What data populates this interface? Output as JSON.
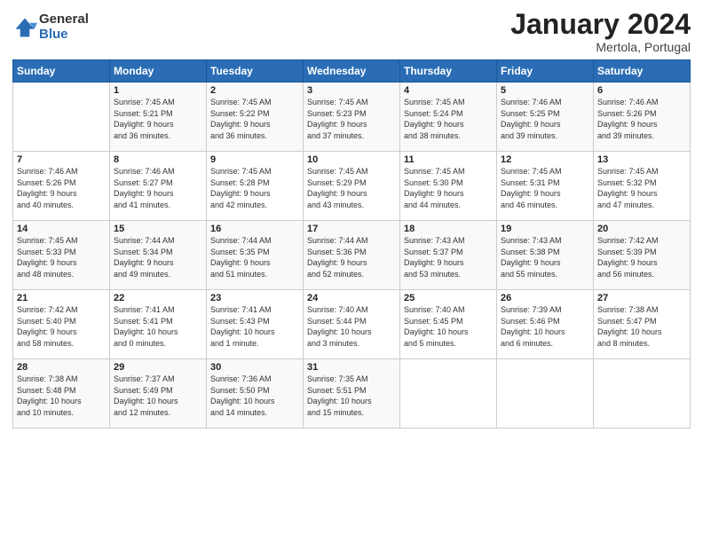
{
  "logo": {
    "general": "General",
    "blue": "Blue"
  },
  "title": "January 2024",
  "subtitle": "Mertola, Portugal",
  "days_header": [
    "Sunday",
    "Monday",
    "Tuesday",
    "Wednesday",
    "Thursday",
    "Friday",
    "Saturday"
  ],
  "weeks": [
    [
      {
        "num": "",
        "info": ""
      },
      {
        "num": "1",
        "info": "Sunrise: 7:45 AM\nSunset: 5:21 PM\nDaylight: 9 hours\nand 36 minutes."
      },
      {
        "num": "2",
        "info": "Sunrise: 7:45 AM\nSunset: 5:22 PM\nDaylight: 9 hours\nand 36 minutes."
      },
      {
        "num": "3",
        "info": "Sunrise: 7:45 AM\nSunset: 5:23 PM\nDaylight: 9 hours\nand 37 minutes."
      },
      {
        "num": "4",
        "info": "Sunrise: 7:45 AM\nSunset: 5:24 PM\nDaylight: 9 hours\nand 38 minutes."
      },
      {
        "num": "5",
        "info": "Sunrise: 7:46 AM\nSunset: 5:25 PM\nDaylight: 9 hours\nand 39 minutes."
      },
      {
        "num": "6",
        "info": "Sunrise: 7:46 AM\nSunset: 5:26 PM\nDaylight: 9 hours\nand 39 minutes."
      }
    ],
    [
      {
        "num": "7",
        "info": "Sunrise: 7:46 AM\nSunset: 5:26 PM\nDaylight: 9 hours\nand 40 minutes."
      },
      {
        "num": "8",
        "info": "Sunrise: 7:46 AM\nSunset: 5:27 PM\nDaylight: 9 hours\nand 41 minutes."
      },
      {
        "num": "9",
        "info": "Sunrise: 7:45 AM\nSunset: 5:28 PM\nDaylight: 9 hours\nand 42 minutes."
      },
      {
        "num": "10",
        "info": "Sunrise: 7:45 AM\nSunset: 5:29 PM\nDaylight: 9 hours\nand 43 minutes."
      },
      {
        "num": "11",
        "info": "Sunrise: 7:45 AM\nSunset: 5:30 PM\nDaylight: 9 hours\nand 44 minutes."
      },
      {
        "num": "12",
        "info": "Sunrise: 7:45 AM\nSunset: 5:31 PM\nDaylight: 9 hours\nand 46 minutes."
      },
      {
        "num": "13",
        "info": "Sunrise: 7:45 AM\nSunset: 5:32 PM\nDaylight: 9 hours\nand 47 minutes."
      }
    ],
    [
      {
        "num": "14",
        "info": "Sunrise: 7:45 AM\nSunset: 5:33 PM\nDaylight: 9 hours\nand 48 minutes."
      },
      {
        "num": "15",
        "info": "Sunrise: 7:44 AM\nSunset: 5:34 PM\nDaylight: 9 hours\nand 49 minutes."
      },
      {
        "num": "16",
        "info": "Sunrise: 7:44 AM\nSunset: 5:35 PM\nDaylight: 9 hours\nand 51 minutes."
      },
      {
        "num": "17",
        "info": "Sunrise: 7:44 AM\nSunset: 5:36 PM\nDaylight: 9 hours\nand 52 minutes."
      },
      {
        "num": "18",
        "info": "Sunrise: 7:43 AM\nSunset: 5:37 PM\nDaylight: 9 hours\nand 53 minutes."
      },
      {
        "num": "19",
        "info": "Sunrise: 7:43 AM\nSunset: 5:38 PM\nDaylight: 9 hours\nand 55 minutes."
      },
      {
        "num": "20",
        "info": "Sunrise: 7:42 AM\nSunset: 5:39 PM\nDaylight: 9 hours\nand 56 minutes."
      }
    ],
    [
      {
        "num": "21",
        "info": "Sunrise: 7:42 AM\nSunset: 5:40 PM\nDaylight: 9 hours\nand 58 minutes."
      },
      {
        "num": "22",
        "info": "Sunrise: 7:41 AM\nSunset: 5:41 PM\nDaylight: 10 hours\nand 0 minutes."
      },
      {
        "num": "23",
        "info": "Sunrise: 7:41 AM\nSunset: 5:43 PM\nDaylight: 10 hours\nand 1 minute."
      },
      {
        "num": "24",
        "info": "Sunrise: 7:40 AM\nSunset: 5:44 PM\nDaylight: 10 hours\nand 3 minutes."
      },
      {
        "num": "25",
        "info": "Sunrise: 7:40 AM\nSunset: 5:45 PM\nDaylight: 10 hours\nand 5 minutes."
      },
      {
        "num": "26",
        "info": "Sunrise: 7:39 AM\nSunset: 5:46 PM\nDaylight: 10 hours\nand 6 minutes."
      },
      {
        "num": "27",
        "info": "Sunrise: 7:38 AM\nSunset: 5:47 PM\nDaylight: 10 hours\nand 8 minutes."
      }
    ],
    [
      {
        "num": "28",
        "info": "Sunrise: 7:38 AM\nSunset: 5:48 PM\nDaylight: 10 hours\nand 10 minutes."
      },
      {
        "num": "29",
        "info": "Sunrise: 7:37 AM\nSunset: 5:49 PM\nDaylight: 10 hours\nand 12 minutes."
      },
      {
        "num": "30",
        "info": "Sunrise: 7:36 AM\nSunset: 5:50 PM\nDaylight: 10 hours\nand 14 minutes."
      },
      {
        "num": "31",
        "info": "Sunrise: 7:35 AM\nSunset: 5:51 PM\nDaylight: 10 hours\nand 15 minutes."
      },
      {
        "num": "",
        "info": ""
      },
      {
        "num": "",
        "info": ""
      },
      {
        "num": "",
        "info": ""
      }
    ]
  ]
}
